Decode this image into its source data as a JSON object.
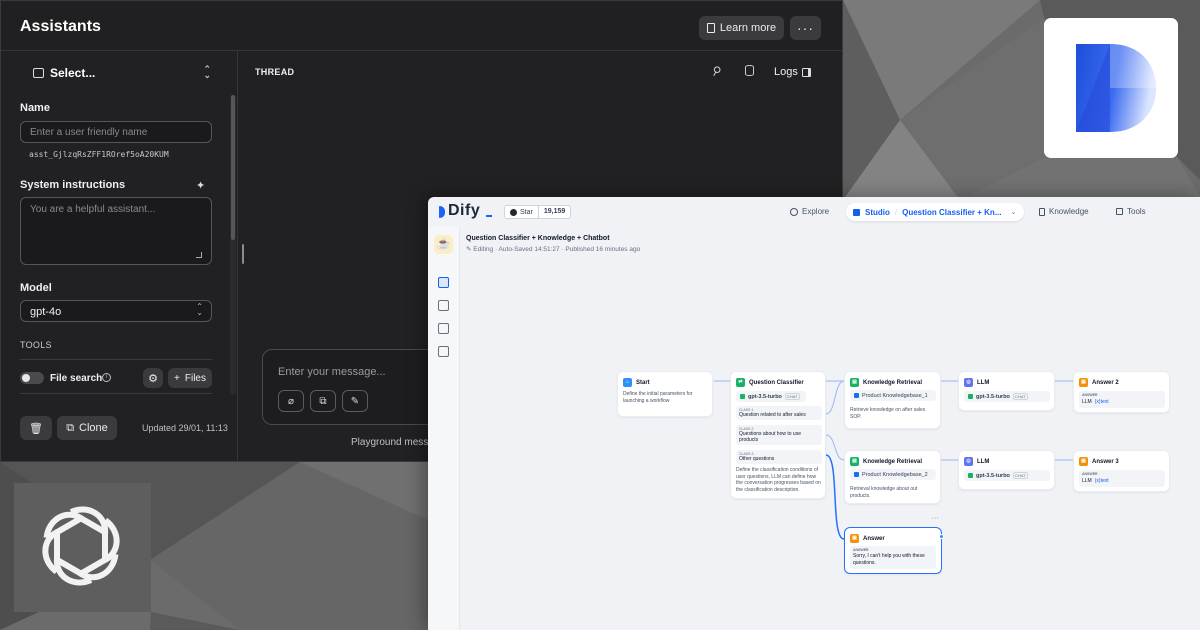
{
  "colors": {
    "assist_bg": "#212123",
    "dify_accent": "#155eef",
    "node_start": "#2e90fa",
    "node_classifier": "#16b364",
    "node_llm": "#6172f3",
    "node_answer": "#f79009"
  },
  "assistants": {
    "title": "Assistants",
    "learn_more": "Learn more",
    "more_label": "···",
    "selector": {
      "label": "Select...",
      "icon": "robot-icon"
    },
    "name_label": "Name",
    "name_placeholder": "Enter a user friendly name",
    "assistant_id": "asst_GjlzqRsZFF1ROref5oA20KUM",
    "instructions_label": "System instructions",
    "instructions_placeholder": "You are a helpful assistant...",
    "model_label": "Model",
    "model_value": "gpt-4o",
    "tools_label": "TOOLS",
    "file_search_label": "File search",
    "files_button": "Files",
    "files_plus": "+",
    "clone_button": "Clone",
    "updated_text": "Updated 29/01, 11:13",
    "thread_label": "THREAD",
    "logs_label": "Logs",
    "message_placeholder": "Enter your message...",
    "playground_text": "Playground mess"
  },
  "dify": {
    "brand": "Dify",
    "github_star": "Star",
    "star_count": "19,159",
    "nav": {
      "explore": "Explore",
      "studio": "Studio",
      "app_name": "Question Classifier + Kn...",
      "knowledge": "Knowledge",
      "tools": "Tools"
    },
    "app_title": "Question Classifier + Knowledge + Chatbot",
    "app_status": "Editing · Auto-Saved 14:51:27 · Published 16 minutes ago",
    "nodes": {
      "start": {
        "title": "Start",
        "desc": "Define the initial parameters for launching a workflow"
      },
      "classifier": {
        "title": "Question Classifier",
        "model": "gpt-3.5-turbo",
        "model_tag": "CHAT",
        "classes": [
          {
            "key": "CLASS 1",
            "text": "Question related to after sales"
          },
          {
            "key": "CLASS 2",
            "text": "Questions about how to use products"
          },
          {
            "key": "CLASS 3",
            "text": "Other questions"
          }
        ],
        "desc": "Define the classification conditions of user questions, LLM can define how the conversation progresses based on the classification description."
      },
      "kr1": {
        "title": "Knowledge Retrieval",
        "dataset": "Product Knowledgebase_1",
        "desc": "Retrieve knowledge on after sales SOP."
      },
      "kr2": {
        "title": "Knowledge Retrieval",
        "dataset": "Product Knowledgebase_2",
        "desc": "Retrieval knowledge about out products."
      },
      "llm1": {
        "title": "LLM",
        "model": "gpt-3.5-turbo",
        "model_tag": "CHAT"
      },
      "llm2": {
        "title": "LLM",
        "model": "gpt-3.5-turbo",
        "model_tag": "CHAT"
      },
      "answer2": {
        "title": "Answer 2",
        "label": "ANSWER",
        "source": "LLM",
        "var": "{x}text"
      },
      "answer3": {
        "title": "Answer 3",
        "label": "ANSWER",
        "source": "LLM",
        "var": "{x}text"
      },
      "answer": {
        "title": "Answer",
        "label": "ANSWER",
        "text": "Sorry, I can't help you with these questions."
      }
    }
  }
}
